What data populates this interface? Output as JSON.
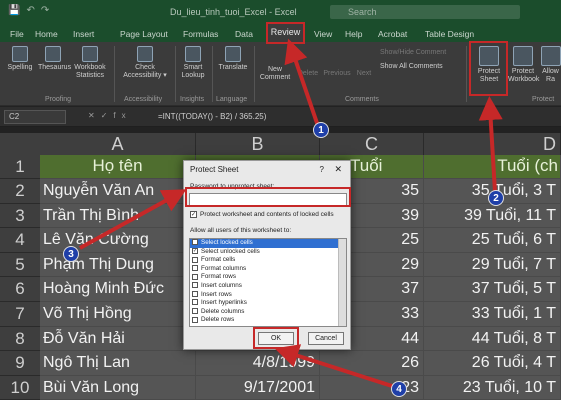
{
  "window": {
    "title": "Du_lieu_tinh_tuoi_Excel - Excel",
    "search": "Search"
  },
  "tabs": [
    "File",
    "Home",
    "Insert",
    "Page Layout",
    "Formulas",
    "Data",
    "Review",
    "View",
    "Help",
    "Acrobat",
    "Table Design"
  ],
  "ribbon": {
    "spelling": "Spelling",
    "thesaurus": "Thesaurus",
    "workbook_stats_1": "Workbook",
    "workbook_stats_2": "Statistics",
    "check_1": "Check",
    "check_2": "Accessibility ▾",
    "smart_1": "Smart",
    "smart_2": "Lookup",
    "translate": "Translate",
    "new_1": "New",
    "new_2": "Comment",
    "delete": "Delete",
    "previous": "Previous",
    "next": "Next",
    "show_hide": "Show/Hide Comment",
    "show_all": "Show All Comments",
    "protect_sheet_1": "Protect",
    "protect_sheet_2": "Sheet",
    "protect_wb_1": "Protect",
    "protect_wb_2": "Workbook",
    "allow_1": "Allow",
    "allow_2": "Ra",
    "groups": {
      "proofing": "Proofing",
      "accessibility": "Accessibility",
      "insights": "Insights",
      "language": "Language",
      "comments": "Comments",
      "protect": "Protect"
    }
  },
  "formula_bar": {
    "name_box": "C2",
    "formula": "=INT((TODAY() - B2) / 365.25)"
  },
  "columns": [
    "A",
    "B",
    "C",
    "D"
  ],
  "header_row": {
    "num": "1",
    "a": "Họ tên",
    "c": "Tuổi",
    "d": "Tuổi (ch"
  },
  "rows": [
    {
      "num": "2",
      "a": "Nguyễn Văn An",
      "b": "",
      "c": "35",
      "d": "35 Tuổi, 3 T"
    },
    {
      "num": "3",
      "a": "Trần Thị Bình",
      "b": "",
      "c": "39",
      "d": "39 Tuổi, 11 T"
    },
    {
      "num": "4",
      "a": "Lê Văn Cường",
      "b": "",
      "c": "25",
      "d": "25 Tuổi, 6 T"
    },
    {
      "num": "5",
      "a": "Phạm Thị Dung",
      "b": "",
      "c": "29",
      "d": "29 Tuổi, 7 T"
    },
    {
      "num": "6",
      "a": "Hoàng Minh Đức",
      "b": "",
      "c": "37",
      "d": "37 Tuổi, 5 T"
    },
    {
      "num": "7",
      "a": "Võ Thị Hồng",
      "b": "",
      "c": "33",
      "d": "33 Tuổi, 1 T"
    },
    {
      "num": "8",
      "a": "Đỗ Văn Hải",
      "b": "",
      "c": "44",
      "d": "44 Tuổi, 8 T"
    },
    {
      "num": "9",
      "a": "Ngô Thị Lan",
      "b": "4/8/1999",
      "c": "26",
      "d": "26 Tuổi, 4 T"
    },
    {
      "num": "10",
      "a": "Bùi Văn Long",
      "b": "9/17/2001",
      "c": "23",
      "d": "23 Tuổi, 10 T"
    }
  ],
  "dialog": {
    "title": "Protect Sheet",
    "help": "?",
    "close": "✕",
    "password_label": "Password to unprotect sheet:",
    "protect_check": "Protect worksheet and contents of locked cells",
    "allow_label": "Allow all users of this worksheet to:",
    "options": [
      "Select locked cells",
      "Select unlocked cells",
      "Format cells",
      "Format columns",
      "Format rows",
      "Insert columns",
      "Insert rows",
      "Insert hyperlinks",
      "Delete columns",
      "Delete rows"
    ],
    "ok": "OK",
    "cancel": "Cancel"
  },
  "badges": [
    "1",
    "2",
    "3",
    "4"
  ],
  "colors": {
    "annotation_red": "#c62828",
    "badge_blue": "#1f3fa8",
    "header_green": "#4f6e2f"
  }
}
